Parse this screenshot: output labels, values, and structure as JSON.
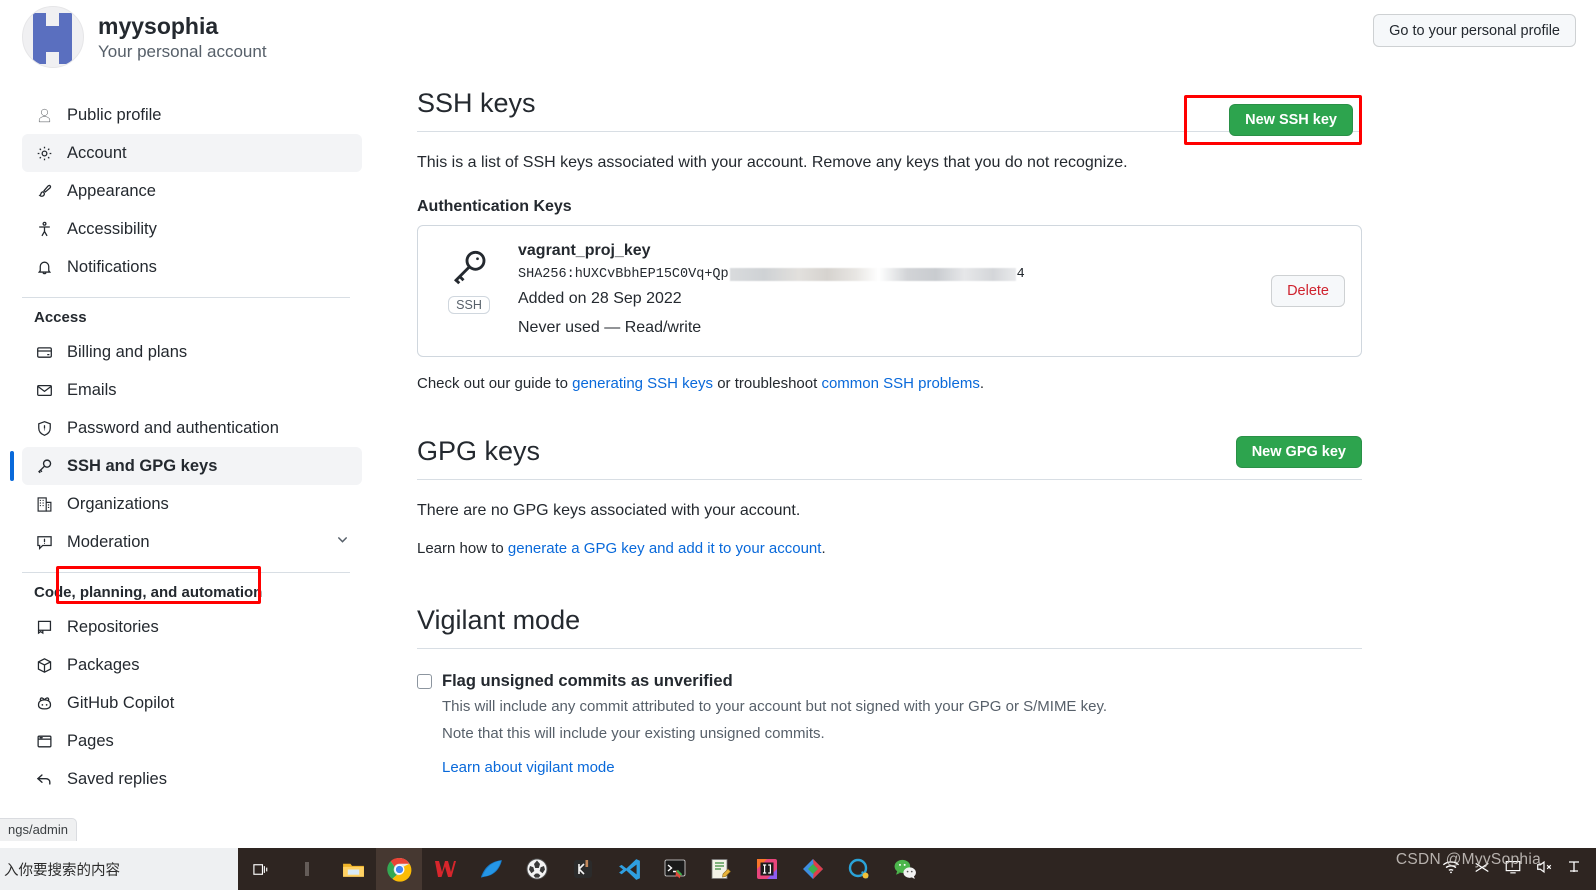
{
  "header": {
    "account_name": "myysophia",
    "account_subtitle": "Your personal account",
    "profile_button": "Go to your personal profile"
  },
  "sidebar": {
    "items_top": [
      {
        "label": "Public profile",
        "icon": "person-icon",
        "state": "normal"
      },
      {
        "label": "Account",
        "icon": "gear-icon",
        "state": "selected"
      },
      {
        "label": "Appearance",
        "icon": "paintbrush-icon",
        "state": "normal"
      },
      {
        "label": "Accessibility",
        "icon": "accessibility-icon",
        "state": "normal"
      },
      {
        "label": "Notifications",
        "icon": "bell-icon",
        "state": "normal"
      }
    ],
    "group_access": "Access",
    "items_access": [
      {
        "label": "Billing and plans",
        "icon": "credit-card-icon",
        "state": "normal"
      },
      {
        "label": "Emails",
        "icon": "mail-icon",
        "state": "normal"
      },
      {
        "label": "Password and authentication",
        "icon": "shield-icon",
        "state": "normal"
      },
      {
        "label": "SSH and GPG keys",
        "icon": "key-icon",
        "state": "current"
      },
      {
        "label": "Organizations",
        "icon": "organization-icon",
        "state": "normal"
      },
      {
        "label": "Moderation",
        "icon": "report-icon",
        "state": "normal",
        "chevron": "chevron-down-icon"
      }
    ],
    "group_code": "Code, planning, and automation",
    "items_code": [
      {
        "label": "Repositories",
        "icon": "repo-icon",
        "state": "normal"
      },
      {
        "label": "Packages",
        "icon": "package-icon",
        "state": "normal"
      },
      {
        "label": "GitHub Copilot",
        "icon": "copilot-icon",
        "state": "normal"
      },
      {
        "label": "Pages",
        "icon": "browser-icon",
        "state": "normal"
      },
      {
        "label": "Saved replies",
        "icon": "reply-icon",
        "state": "normal"
      }
    ]
  },
  "ssh_section": {
    "title": "SSH keys",
    "new_key_button": "New SSH key",
    "description": "This is a list of SSH keys associated with your account. Remove any keys that you do not recognize.",
    "subheading": "Authentication Keys",
    "key": {
      "name": "vagrant_proj_key",
      "fingerprint_prefix": "SHA256:hUXCvBbhEP15C0Vq+Qp",
      "fingerprint_suffix": "4",
      "added": "Added on 28 Sep 2022",
      "usage": "Never used — Read/write",
      "delete_button": "Delete",
      "badge": "SSH"
    },
    "footer_prefix": "Check out our guide to ",
    "footer_link1": "generating SSH keys",
    "footer_middle": " or troubleshoot ",
    "footer_link2": "common SSH problems",
    "footer_suffix": "."
  },
  "gpg_section": {
    "title": "GPG keys",
    "new_key_button": "New GPG key",
    "empty_text": "There are no GPG keys associated with your account.",
    "learn_prefix": "Learn how to ",
    "learn_link": "generate a GPG key and add it to your account",
    "learn_suffix": "."
  },
  "vigilant_section": {
    "title": "Vigilant mode",
    "checkbox_label": "Flag unsigned commits as unverified",
    "desc_line1": "This will include any commit attributed to your account but not signed with your GPG or S/MIME key.",
    "desc_line2": "Note that this will include your existing unsigned commits.",
    "learn_link": "Learn about vigilant mode"
  },
  "browser": {
    "status_url": "ngs/admin"
  },
  "taskbar": {
    "search_placeholder": "入你要搜索的内容",
    "icons": [
      {
        "name": "task-view-icon"
      },
      {
        "name": "divider-icon"
      },
      {
        "name": "file-explorer-icon"
      },
      {
        "name": "chrome-icon"
      },
      {
        "name": "wps-office-icon"
      },
      {
        "name": "wireshark-icon"
      },
      {
        "name": "game-globe-icon"
      },
      {
        "name": "keil-icon"
      },
      {
        "name": "vscode-icon"
      },
      {
        "name": "terminal-icon"
      },
      {
        "name": "editor-icon"
      },
      {
        "name": "intellij-idea-icon"
      },
      {
        "name": "diamond-app-icon"
      },
      {
        "name": "qq-icon"
      },
      {
        "name": "wechat-icon"
      }
    ],
    "tray": [
      {
        "name": "wifi-icon"
      },
      {
        "name": "network-icon"
      },
      {
        "name": "display-icon"
      },
      {
        "name": "volume-mute-icon"
      },
      {
        "name": "ime-icon"
      }
    ],
    "watermark": "CSDN @MyySophia"
  },
  "colors": {
    "green_button": "#2da44e",
    "link_blue": "#0969da",
    "annotation_red": "#ff0000",
    "delete_red": "#cf222e",
    "accent_bar": "#0969da"
  }
}
